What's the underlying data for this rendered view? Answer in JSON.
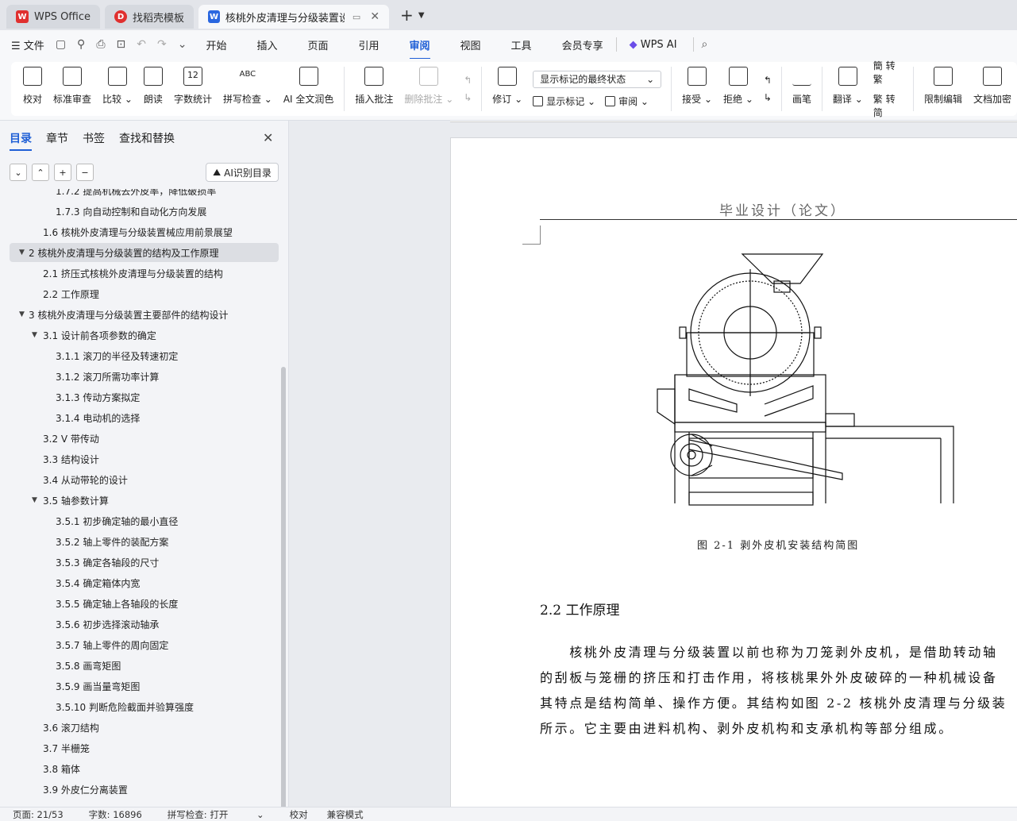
{
  "tabs": [
    {
      "label": "WPS Office",
      "logo": "W"
    },
    {
      "label": "找稻壳模板",
      "logo": "D"
    },
    {
      "label": "核桃外皮清理与分级装置设计",
      "logo": "W"
    }
  ],
  "menu": {
    "file": "文件",
    "items": [
      "开始",
      "插入",
      "页面",
      "引用",
      "审阅",
      "视图",
      "工具",
      "会员专享"
    ],
    "active": "审阅",
    "ai": "WPS AI"
  },
  "ribbon": {
    "proofread": "校对",
    "standard_review": "标准审查",
    "compare": "比较",
    "read_aloud": "朗读",
    "word_count": "字数统计",
    "spell_check": "拼写检查",
    "ai_polish": "AI 全文润色",
    "insert_comment": "插入批注",
    "delete_comment": "删除批注",
    "track_changes": "修订",
    "markup_state": "显示标记的最终状态",
    "show_markup": "显示标记",
    "review_pane": "审阅",
    "accept": "接受",
    "reject": "拒绝",
    "pen": "画笔",
    "translate": "翻译",
    "to_traditional": "转繁",
    "to_simplified": "转简",
    "restrict_edit": "限制编辑",
    "doc_encrypt": "文档加密"
  },
  "left_panel": {
    "tabs": [
      "目录",
      "章节",
      "书签",
      "查找和替换"
    ],
    "active_tab": "目录",
    "ai_toc": "AI识别目录",
    "toc": [
      {
        "text": "1.7.2  提高机械去外皮率，降低破损率",
        "level": 3,
        "arrow": ""
      },
      {
        "text": "1.7.3  向自动控制和自动化方向发展",
        "level": 3,
        "arrow": ""
      },
      {
        "text": "1.6  核桃外皮清理与分级装置械应用前景展望",
        "level": 2,
        "arrow": ""
      },
      {
        "text": "2   核桃外皮清理与分级装置的结构及工作原理",
        "level": 1,
        "arrow": "▼",
        "selected": true
      },
      {
        "text": "2.1  挤压式核桃外皮清理与分级装置的结构",
        "level": 2,
        "arrow": ""
      },
      {
        "text": "2.2  工作原理",
        "level": 2,
        "arrow": ""
      },
      {
        "text": "3   核桃外皮清理与分级装置主要部件的结构设计",
        "level": 1,
        "arrow": "▼"
      },
      {
        "text": "3.1 设计前各项参数的确定",
        "level": 2,
        "arrow": "▼"
      },
      {
        "text": "3.1.1  滚刀的半径及转速初定",
        "level": 3,
        "arrow": ""
      },
      {
        "text": "3.1.2  滚刀所需功率计算",
        "level": 3,
        "arrow": ""
      },
      {
        "text": "3.1.3  传动方案拟定",
        "level": 3,
        "arrow": ""
      },
      {
        "text": "3.1.4  电动机的选择",
        "level": 3,
        "arrow": ""
      },
      {
        "text": "3.2 V 带传动",
        "level": 2,
        "arrow": ""
      },
      {
        "text": "3.3  结构设计",
        "level": 2,
        "arrow": ""
      },
      {
        "text": "3.4  从动带轮的设计",
        "level": 2,
        "arrow": ""
      },
      {
        "text": "3.5  轴参数计算",
        "level": 2,
        "arrow": "▼"
      },
      {
        "text": "3.5.1  初步确定轴的最小直径",
        "level": 3,
        "arrow": ""
      },
      {
        "text": "3.5.2  轴上零件的装配方案",
        "level": 3,
        "arrow": ""
      },
      {
        "text": "3.5.3  确定各轴段的尺寸",
        "level": 3,
        "arrow": ""
      },
      {
        "text": "3.5.4  确定箱体内宽",
        "level": 3,
        "arrow": ""
      },
      {
        "text": "3.5.5  确定轴上各轴段的长度",
        "level": 3,
        "arrow": ""
      },
      {
        "text": "3.5.6  初步选择滚动轴承",
        "level": 3,
        "arrow": ""
      },
      {
        "text": "3.5.7  轴上零件的周向固定",
        "level": 3,
        "arrow": ""
      },
      {
        "text": "3.5.8  画弯矩图",
        "level": 3,
        "arrow": ""
      },
      {
        "text": "3.5.9  画当量弯矩图",
        "level": 3,
        "arrow": ""
      },
      {
        "text": "3.5.10  判断危险截面并验算强度",
        "level": 3,
        "arrow": ""
      },
      {
        "text": "3.6  滚刀结构",
        "level": 2,
        "arrow": ""
      },
      {
        "text": "3.7  半栅笼",
        "level": 2,
        "arrow": ""
      },
      {
        "text": "3.8  箱体",
        "level": 2,
        "arrow": ""
      },
      {
        "text": "3.9  外皮仁分离装置",
        "level": 2,
        "arrow": ""
      }
    ]
  },
  "document": {
    "header": "毕业设计（论文）",
    "caption": "图 2-1  剥外皮机安装结构简图",
    "heading": "2.2  工作原理",
    "paragraph_lines": [
      "　　核桃外皮清理与分级装置以前也称为刀笼剥外皮机，是借助转动轴",
      "的刮板与笼栅的挤压和打击作用，将核桃果外外皮破碎的一种机械设备",
      "其特点是结构简单、操作方便。其结构如图 2-2 核桃外皮清理与分级装",
      "所示。它主要由进料机构、剥外皮机构和支承机构等部分组成。"
    ]
  },
  "status": {
    "page": "页面: 21/53",
    "words": "字数: 16896",
    "spell": "拼写检查: 打开",
    "proof": "校对",
    "compat": "兼容模式"
  },
  "colors": {
    "accent": "#1f5fd6",
    "wps_red": "#e0302f"
  }
}
